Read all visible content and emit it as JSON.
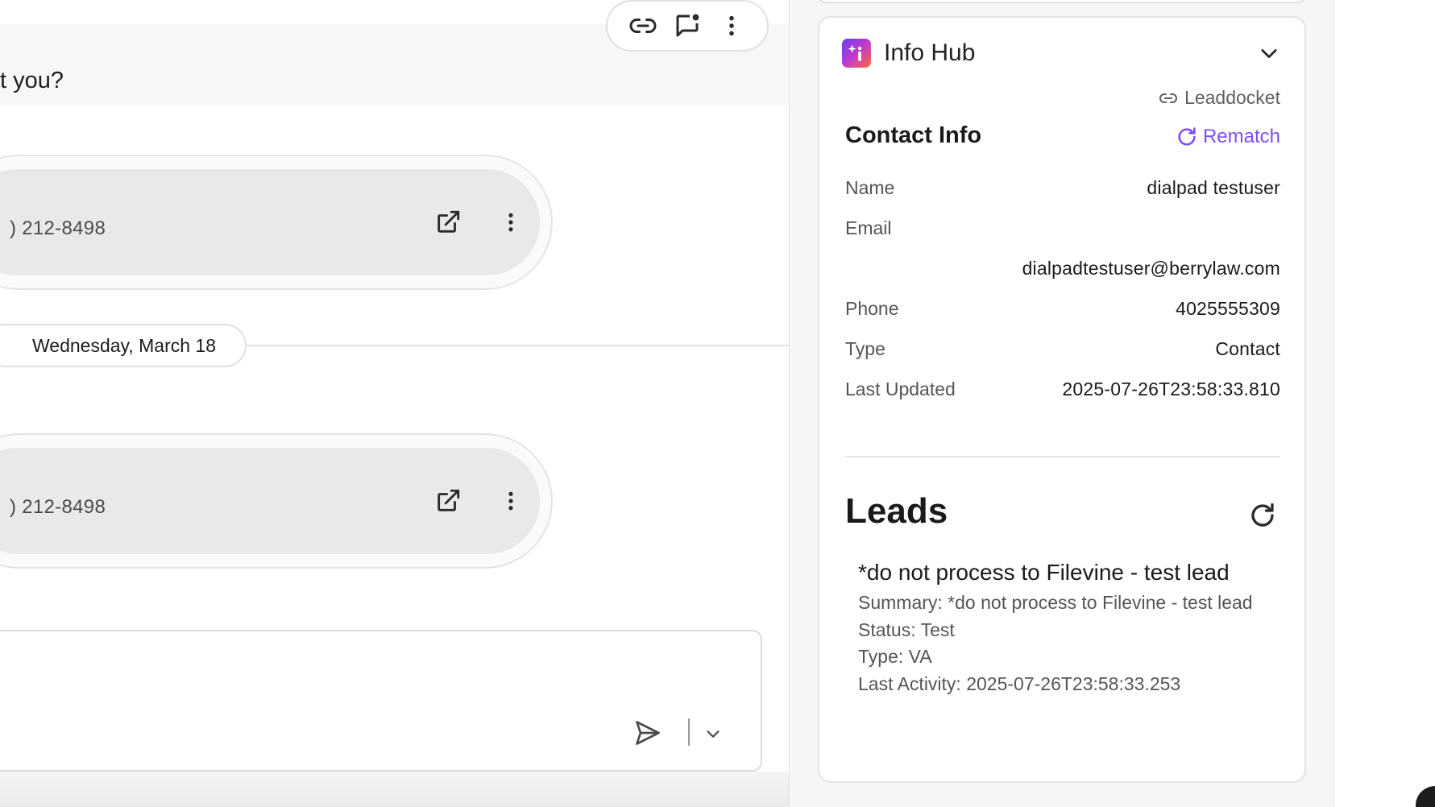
{
  "chat": {
    "question_fragment": "t you?",
    "toolbar": {
      "link_icon": "link-icon",
      "note_icon": "note-badge-icon",
      "more_icon": "more-vertical-icon"
    },
    "calls": [
      {
        "number": ") 212-8498"
      },
      {
        "number": ") 212-8498"
      }
    ],
    "date_separator": "Wednesday, March 18",
    "composer": {
      "send_icon": "send-icon",
      "dropdown_icon": "chevron-down-icon"
    }
  },
  "info_hub": {
    "title": "Info Hub",
    "source_link": "Leaddocket",
    "contact": {
      "heading": "Contact Info",
      "rematch_label": "Rematch",
      "fields": [
        {
          "label": "Name",
          "value": "dialpad testuser"
        },
        {
          "label": "Email",
          "value": "dialpadtestuser@berrylaw.com"
        },
        {
          "label": "Phone",
          "value": "4025555309"
        },
        {
          "label": "Type",
          "value": "Contact"
        },
        {
          "label": "Last Updated",
          "value": "2025-07-26T23:58:33.810"
        }
      ]
    },
    "leads": {
      "heading": "Leads",
      "items": [
        {
          "title": "*do not process to Filevine - test lead",
          "summary": "Summary: *do not process to Filevine - test lead",
          "status": "Status: Test",
          "type": "Type: VA",
          "last_activity": "Last Activity: 2025-07-26T23:58:33.253"
        }
      ]
    }
  }
}
